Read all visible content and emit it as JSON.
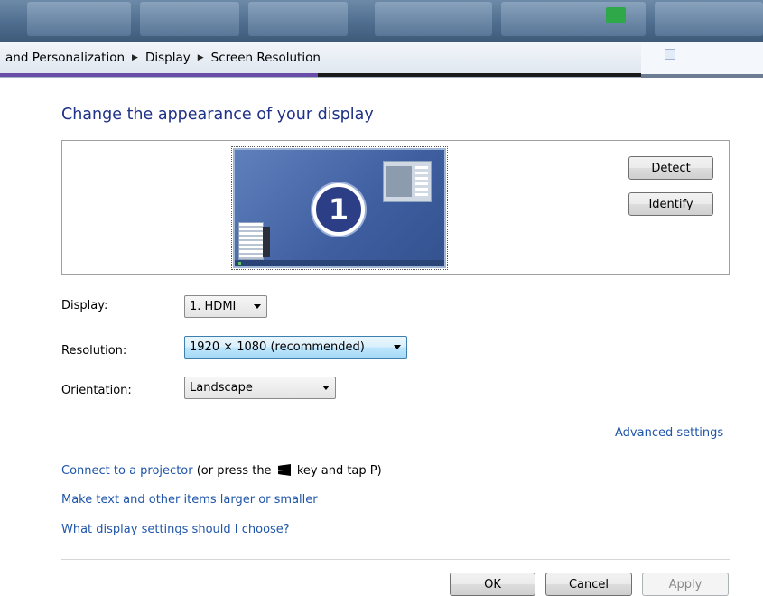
{
  "breadcrumb": {
    "items": [
      "and Personalization",
      "Display",
      "Screen Resolution"
    ]
  },
  "page": {
    "title": "Change the appearance of your display"
  },
  "monitor": {
    "number": "1"
  },
  "buttons": {
    "detect": "Detect",
    "identify": "Identify",
    "ok": "OK",
    "cancel": "Cancel",
    "apply": "Apply"
  },
  "fields": {
    "display_label": "Display:",
    "display_value": "1. HDMI",
    "resolution_label": "Resolution:",
    "resolution_value": "1920 × 1080 (recommended)",
    "orientation_label": "Orientation:",
    "orientation_value": "Landscape"
  },
  "links": {
    "advanced": "Advanced settings",
    "projector": "Connect to a projector",
    "projector_hint_before": " (or press the",
    "projector_hint_after": "key and tap P)",
    "text_size": "Make text and other items larger or smaller",
    "which_settings": "What display settings should I choose?"
  },
  "colors": {
    "link": "#1e55a8",
    "title": "#1e3287",
    "accent_purple": "#6a4da8"
  }
}
